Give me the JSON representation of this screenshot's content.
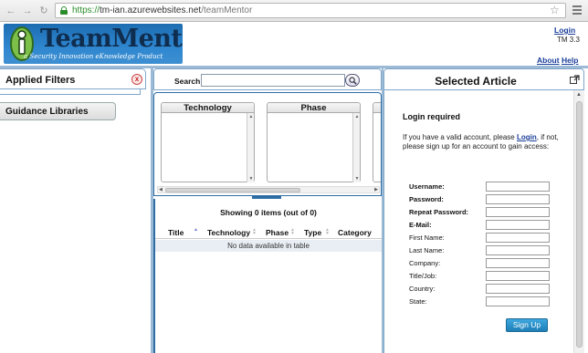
{
  "browser": {
    "url_scheme": "https://",
    "url_host": "tm-ian.azurewebsites.net",
    "url_path": "/teamMentor",
    "back_icon": "arrow-left-icon",
    "forward_icon": "arrow-right-icon",
    "reload_icon": "reload-icon",
    "secure_icon": "lock-icon",
    "bookmark_icon": "star-icon",
    "menu_icon": "hamburger-menu-icon"
  },
  "header": {
    "logo_text": "TeamMentor",
    "logo_tagline": "a Security Innovation eKnowledge Product",
    "login_label": "Login",
    "version": "TM 3.3",
    "about_label": "About",
    "help_label": "Help"
  },
  "left_pane": {
    "applied_filters_title": "Applied Filters",
    "close_label": "x",
    "guidance_libraries_title": "Guidance Libraries"
  },
  "middle_pane": {
    "search_label": "Search",
    "search_value": "",
    "search_icon": "magnifier-icon",
    "filter_columns": [
      "Technology",
      "Phase"
    ],
    "results_count": "Showing 0 items (out of 0)",
    "table_headers": [
      "Title",
      "Technology",
      "Phase",
      "Type",
      "Category"
    ],
    "empty_message": "No data available in table"
  },
  "right_pane": {
    "title": "Selected Article",
    "popout_icon": "popout-icon",
    "login_required_title": "Login required",
    "intro_text_1": "If you have a valid account, please ",
    "intro_login_link": "Login",
    "intro_text_2": ", if not, please sign up for an account to gain access:",
    "form_fields": [
      {
        "label": "Username:",
        "required": true,
        "value": ""
      },
      {
        "label": "Password:",
        "required": true,
        "value": ""
      },
      {
        "label": "Repeat Password:",
        "required": true,
        "value": ""
      },
      {
        "label": "E-Mail:",
        "required": true,
        "value": ""
      },
      {
        "label": "First Name:",
        "required": false,
        "value": ""
      },
      {
        "label": "Last Name:",
        "required": false,
        "value": ""
      },
      {
        "label": "Company:",
        "required": false,
        "value": ""
      },
      {
        "label": "Title/Job:",
        "required": false,
        "value": ""
      },
      {
        "label": "Country:",
        "required": false,
        "value": ""
      },
      {
        "label": "State:",
        "required": false,
        "value": ""
      }
    ],
    "signup_label": "Sign Up"
  },
  "colors": {
    "link": "#1a3d99",
    "pane_border": "#2e6da4",
    "background": "#9cbad6",
    "button": "#1d7fb7"
  }
}
